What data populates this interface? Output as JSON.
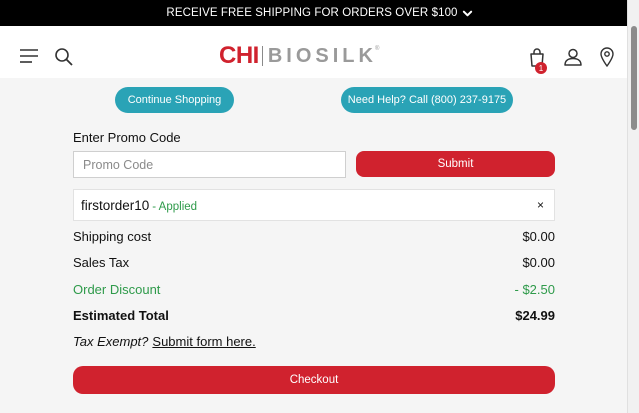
{
  "banner": {
    "text": "RECEIVE FREE SHIPPING FOR ORDERS OVER $100",
    "icon": "chevron-down-icon"
  },
  "header": {
    "logo": {
      "brand_left": "CHI",
      "brand_right": "BIOSILK",
      "reg_mark": "®",
      "brand_color": "#d0222e"
    },
    "icons": [
      "menu-icon",
      "search-icon",
      "cart-icon",
      "account-icon",
      "location-icon"
    ],
    "cart_count": "1"
  },
  "actions": {
    "continue_shopping": "Continue Shopping",
    "need_help": "Need Help? Call (800) 237-9175",
    "pill_color": "#2aa3b6"
  },
  "promo": {
    "label": "Enter Promo Code",
    "placeholder": "Promo Code",
    "value": "",
    "submit_label": "Submit",
    "applied_code": "firstorder10",
    "applied_tag": "- Applied",
    "remove_glyph": "×"
  },
  "summary": {
    "rows": [
      {
        "label": "Shipping cost",
        "value": "$0.00"
      },
      {
        "label": "Sales Tax",
        "value": "$0.00"
      },
      {
        "label": "Order Discount",
        "value": "- $2.50"
      },
      {
        "label": "Estimated Total",
        "value": "$24.99"
      }
    ]
  },
  "tax_exempt": {
    "prefix": "Tax Exempt?",
    "link": "Submit form here."
  },
  "checkout": {
    "label": "Checkout",
    "button_color": "#d0222e"
  }
}
